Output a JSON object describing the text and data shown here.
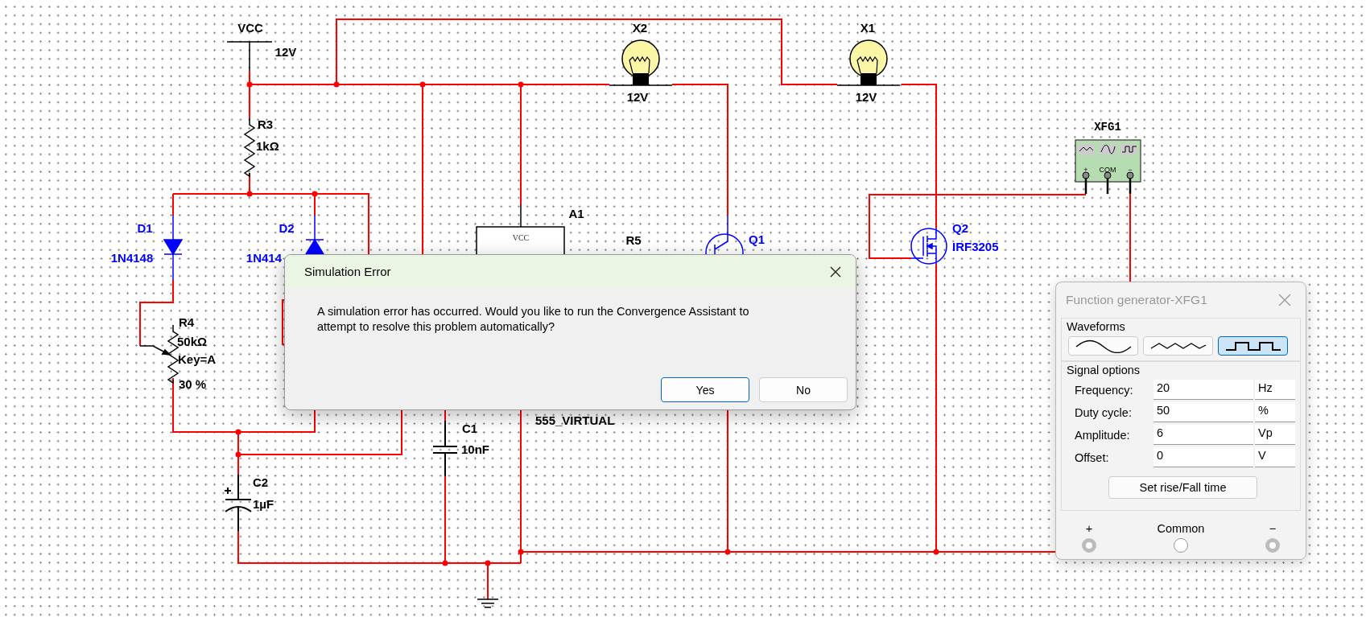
{
  "schematic": {
    "components": [
      {
        "kind": "dc_source",
        "ref": "VCC",
        "value": "12V"
      },
      {
        "kind": "lamp",
        "ref": "X2",
        "value": "12V"
      },
      {
        "kind": "lamp",
        "ref": "X1",
        "value": "12V"
      },
      {
        "kind": "resistor",
        "ref": "R3",
        "value": "1kΩ"
      },
      {
        "kind": "function_generator",
        "ref": "XFG1",
        "terminals": [
          "+",
          "COM",
          "−"
        ]
      },
      {
        "kind": "timer",
        "ref": "A1",
        "pin": "VCC",
        "value": "555_VIRTUAL"
      },
      {
        "kind": "diode",
        "ref": "D1",
        "value": "1N4148"
      },
      {
        "kind": "diode",
        "ref": "D2",
        "value": "1N414"
      },
      {
        "kind": "resistor",
        "ref": "R5"
      },
      {
        "kind": "bjt",
        "ref": "Q1"
      },
      {
        "kind": "mosfet",
        "ref": "Q2",
        "value": "IRF3205"
      },
      {
        "kind": "potentiometer",
        "ref": "R4",
        "value": "50kΩ",
        "key": "Key=A",
        "setting": "30 %"
      },
      {
        "kind": "capacitor",
        "ref": "C1",
        "value": "10nF"
      },
      {
        "kind": "capacitor_polarized",
        "ref": "C2",
        "value": "1µF"
      },
      {
        "kind": "ground"
      }
    ]
  },
  "error_dialog": {
    "title": "Simulation Error",
    "message": "A simulation error has occurred. Would you like to run the Convergence Assistant to attempt to resolve this problem automatically?",
    "buttons": [
      {
        "label": "Yes",
        "default": true
      },
      {
        "label": "No",
        "default": false
      }
    ]
  },
  "function_generator_panel": {
    "title": "Function generator-XFG1",
    "waveforms_label": "Waveforms",
    "waveforms": [
      {
        "kind": "sine",
        "selected": false
      },
      {
        "kind": "triangle",
        "selected": false
      },
      {
        "kind": "square",
        "selected": true
      }
    ],
    "signal_options_label": "Signal options",
    "options": [
      {
        "label": "Frequency:",
        "value": "20",
        "unit": "Hz"
      },
      {
        "label": "Duty cycle:",
        "value": "50",
        "unit": "%"
      },
      {
        "label": "Amplitude:",
        "value": "6",
        "unit": "Vp"
      },
      {
        "label": "Offset:",
        "value": "0",
        "unit": "V"
      }
    ],
    "rise_fall_button": "Set rise/Fall time",
    "terminals": [
      {
        "kind": "positive",
        "label": "+"
      },
      {
        "kind": "common",
        "label": "Common"
      },
      {
        "kind": "negative",
        "label": "−"
      }
    ]
  }
}
